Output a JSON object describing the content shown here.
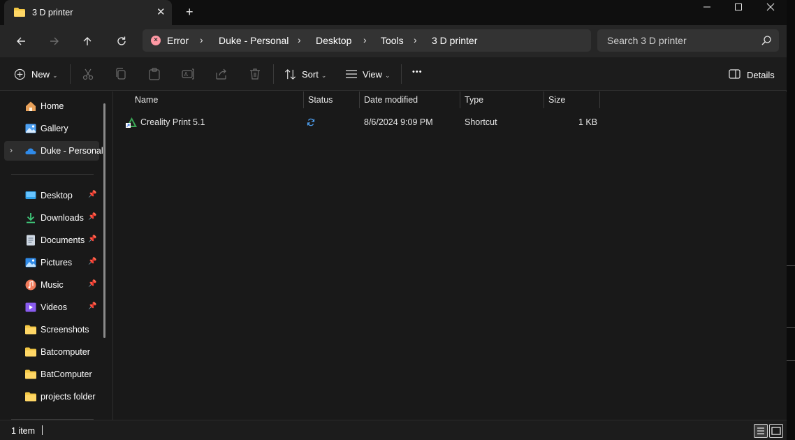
{
  "window": {
    "tab_title": "3 D printer",
    "new_tab": "+",
    "close_tab": "✕"
  },
  "nav": {
    "breadcrumbs": [
      "Error",
      "Duke - Personal",
      "Desktop",
      "Tools",
      "3 D printer"
    ],
    "search_placeholder": "Search 3 D printer"
  },
  "commands": {
    "new": "New",
    "sort": "Sort",
    "view": "View",
    "more": "•••",
    "details": "Details"
  },
  "sidebar": {
    "top_items": [
      {
        "label": "Home",
        "icon": "home-icon"
      },
      {
        "label": "Gallery",
        "icon": "gallery-icon"
      },
      {
        "label": "Duke - Personal",
        "icon": "onedrive-icon",
        "selected": true
      }
    ],
    "pinned_items": [
      {
        "label": "Desktop",
        "icon": "desktop-icon"
      },
      {
        "label": "Downloads",
        "icon": "downloads-icon"
      },
      {
        "label": "Documents",
        "icon": "documents-icon"
      },
      {
        "label": "Pictures",
        "icon": "pictures-icon"
      },
      {
        "label": "Music",
        "icon": "music-icon"
      },
      {
        "label": "Videos",
        "icon": "videos-icon"
      }
    ],
    "folders": [
      "Screenshots",
      "Batcomputer",
      "BatComputer",
      "projects folder"
    ]
  },
  "columns": [
    "Name",
    "Status",
    "Date modified",
    "Type",
    "Size"
  ],
  "files": [
    {
      "name": "Creality Print 5.1",
      "status": "sync-icon",
      "date": "8/6/2024 9:09 PM",
      "type": "Shortcut",
      "size": "1 KB"
    }
  ],
  "status": {
    "count": "1 item"
  },
  "colors": {
    "folder": "#f3c744",
    "accent": "#4ea1f3",
    "error": "#ff99a4"
  }
}
